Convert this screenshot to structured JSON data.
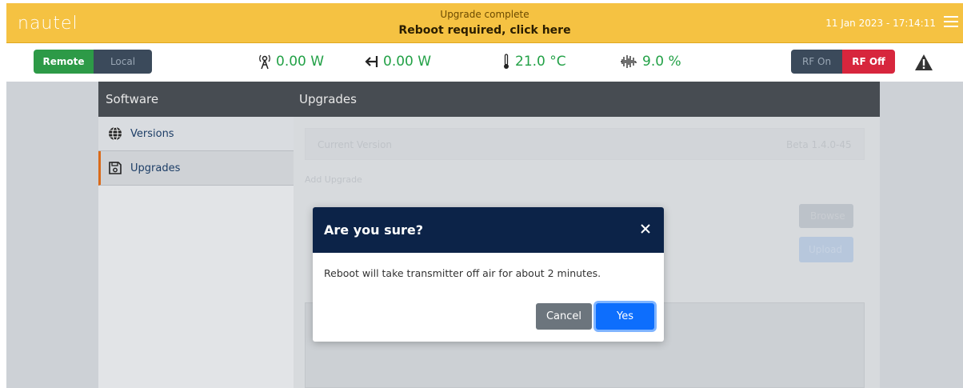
{
  "header": {
    "logo": "nautel",
    "notice_line1": "Upgrade complete",
    "notice_line2": "Reboot required, click here",
    "datetime": "11 Jan 2023 - 17:14:11",
    "menu_icon": "hamburger-icon"
  },
  "status": {
    "remote_label": "Remote",
    "local_label": "Local",
    "forward_power": "0.00 W",
    "reflected_power": "0.00 W",
    "temperature": "21.0 °C",
    "modulation": "9.0 %",
    "rf_on_label": "RF On",
    "rf_off_label": "RF Off",
    "warning_icon": "warning-icon"
  },
  "sidebar": {
    "title": "Software",
    "items": [
      {
        "label": "Versions",
        "icon": "globe-icon"
      },
      {
        "label": "Upgrades",
        "icon": "floppy-disk-icon"
      }
    ]
  },
  "main": {
    "title": "Upgrades",
    "current_version_label": "Current Version",
    "current_version_value": "Beta 1.4.0-45",
    "add_upgrade_label": "Add Upgrade",
    "browse_label": "Browse",
    "upload_label": "Upload"
  },
  "modal": {
    "title": "Are you sure?",
    "body": "Reboot will take transmitter off air for about 2 minutes.",
    "cancel_label": "Cancel",
    "yes_label": "Yes"
  },
  "colors": {
    "banner": "#f5c242",
    "remote_active": "#2d9a47",
    "rf_off_active": "#d7263d",
    "meter_text": "#23a147",
    "modal_header": "#0c2348",
    "primary": "#0d6efd"
  }
}
